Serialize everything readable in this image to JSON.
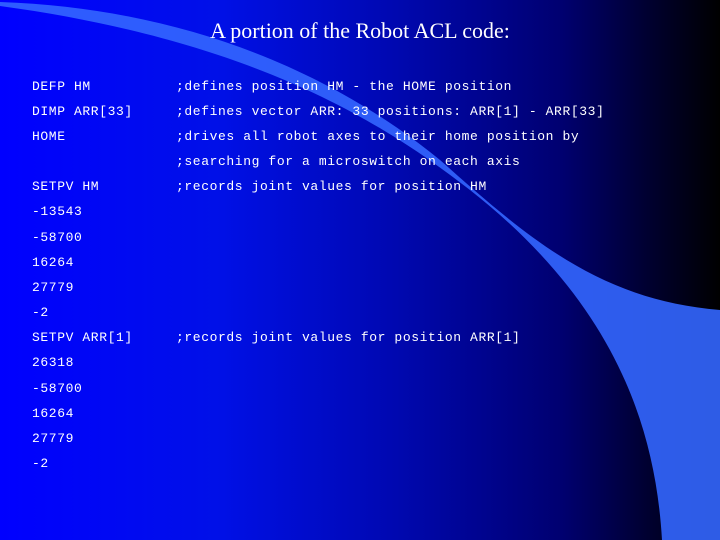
{
  "slide": {
    "title": "A portion of the Robot ACL code:",
    "colors": {
      "background_left": "#0000ff",
      "background_right": "#000000",
      "swoosh": "#3366ff",
      "text": "#ffffff"
    },
    "lines": [
      {
        "command": "DEFP HM",
        "comment": ";defines position HM - the HOME position"
      },
      {
        "command": "DIMP ARR[33]",
        "comment": ";defines vector ARR: 33 positions: ARR[1] - ARR[33]"
      },
      {
        "command": "HOME",
        "comment": ";drives all robot axes to their home position by"
      },
      {
        "command": "",
        "comment": ";searching for a microswitch on each axis"
      },
      {
        "command": "SETPV HM",
        "comment": ";records joint values for position HM"
      },
      {
        "command": "-13543",
        "comment": ""
      },
      {
        "command": "-58700",
        "comment": ""
      },
      {
        "command": "16264",
        "comment": ""
      },
      {
        "command": "27779",
        "comment": ""
      },
      {
        "command": "-2",
        "comment": ""
      },
      {
        "command": "SETPV ARR[1]",
        "comment": ";records joint values for position ARR[1]"
      },
      {
        "command": "26318",
        "comment": ""
      },
      {
        "command": "-58700",
        "comment": ""
      },
      {
        "command": "16264",
        "comment": ""
      },
      {
        "command": "27779",
        "comment": ""
      },
      {
        "command": "-2",
        "comment": ""
      }
    ]
  }
}
